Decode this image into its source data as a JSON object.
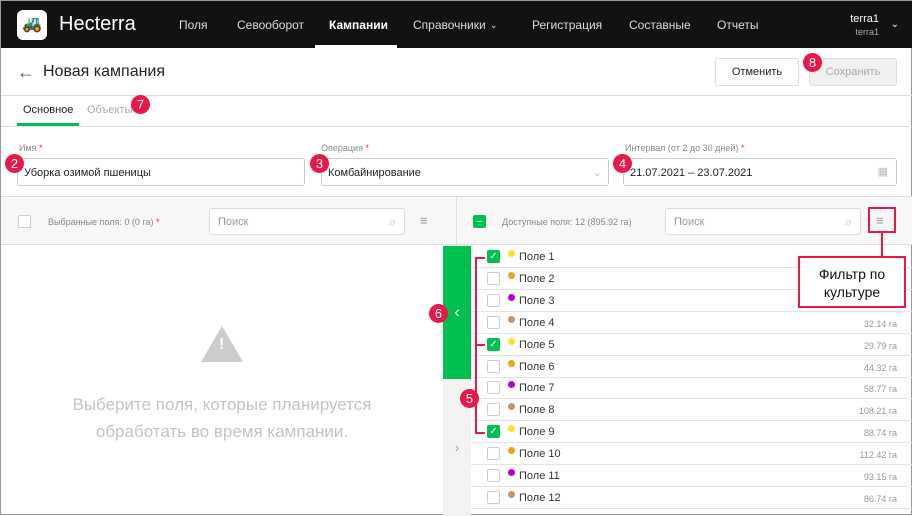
{
  "app": {
    "brand": "Hecterra",
    "logo_icon": "tractor-icon"
  },
  "nav": {
    "items": [
      "Поля",
      "Севооборот",
      "Кампании",
      "Справочники",
      "Регистрация",
      "Составные",
      "Отчеты"
    ],
    "active": "Кампании"
  },
  "user": {
    "name": "terra1",
    "login": "terra1"
  },
  "page": {
    "title": "Новая кампания",
    "cancel": "Отменить",
    "save": "Сохранить"
  },
  "tabs": [
    "Основное",
    "Объекты"
  ],
  "form": {
    "name_label": "Имя",
    "name_value": "Уборка озимой пшеницы",
    "op_label": "Операция",
    "op_value": "Комбайнирование",
    "interval_label": "Интервал (от 2 до 30 дней)",
    "interval_value": "21.07.2021 – 23.07.2021",
    "required": "*"
  },
  "left": {
    "label": "Выбранные поля: 0 (0 га)",
    "search_placeholder": "Поиск",
    "empty": "Выберите поля, которые планируется обработать во время кампании."
  },
  "right": {
    "label": "Доступные поля: 12 (895.92 га)",
    "search_placeholder": "Поиск"
  },
  "fields": [
    {
      "name": "Поле 1",
      "area": "",
      "color": "#ffe030",
      "checked": true
    },
    {
      "name": "Поле 2",
      "area": "",
      "color": "#f5a020",
      "checked": false
    },
    {
      "name": "Поле 3",
      "area": "",
      "color": "#b000e0",
      "checked": false
    },
    {
      "name": "Поле 4",
      "area": "32.14 га",
      "color": "#c4946a",
      "checked": false
    },
    {
      "name": "Поле 5",
      "area": "29.79 га",
      "color": "#ffe030",
      "checked": true
    },
    {
      "name": "Поле 6",
      "area": "44.32 га",
      "color": "#f5a020",
      "checked": false
    },
    {
      "name": "Поле 7",
      "area": "58.77 га",
      "color": "#b000e0",
      "checked": false
    },
    {
      "name": "Поле 8",
      "area": "108.21 га",
      "color": "#c4946a",
      "checked": false
    },
    {
      "name": "Поле 9",
      "area": "88.74 га",
      "color": "#ffe030",
      "checked": true
    },
    {
      "name": "Поле 10",
      "area": "112.42 га",
      "color": "#f5a020",
      "checked": false
    },
    {
      "name": "Поле 11",
      "area": "93.15 га",
      "color": "#b000e0",
      "checked": false
    },
    {
      "name": "Поле 12",
      "area": "86.74 га",
      "color": "#c4946a",
      "checked": false
    }
  ],
  "annotations": {
    "callout": "Фильтр по культуре",
    "badges": [
      "2",
      "3",
      "4",
      "5",
      "6",
      "7",
      "8"
    ]
  }
}
